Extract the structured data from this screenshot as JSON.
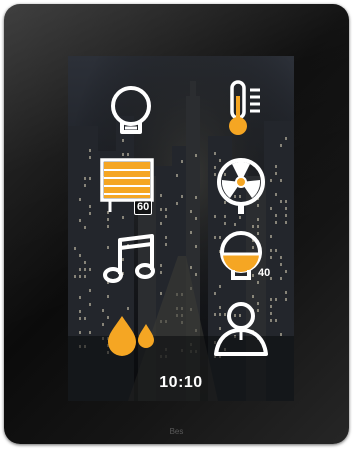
{
  "device": {
    "brand_label": "Bes"
  },
  "screen": {
    "clock": "10:10",
    "tiles": [
      {
        "icon": "lightbulb-icon",
        "label": ""
      },
      {
        "icon": "thermometer-icon",
        "label": ""
      },
      {
        "icon": "blinds-icon",
        "badge": "60"
      },
      {
        "icon": "ventilation-fan-icon",
        "label": ""
      },
      {
        "icon": "music-note-icon",
        "label": ""
      },
      {
        "icon": "dimmer-lamp-icon",
        "badge": "40"
      },
      {
        "icon": "water-drops-icon",
        "label": ""
      },
      {
        "icon": "user-profile-icon",
        "label": ""
      }
    ]
  },
  "colors": {
    "accent": "#F5A623",
    "icon_stroke": "#FFFFFF",
    "bezel": "#111111",
    "screen_bg": "#101317"
  }
}
